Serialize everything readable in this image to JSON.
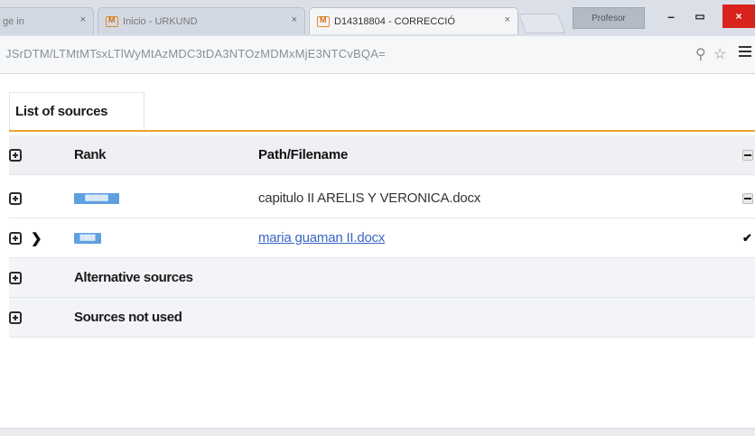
{
  "browser": {
    "tabs": [
      {
        "label": "ge in",
        "close": "×",
        "active": false
      },
      {
        "label": "Inicio - URKUND",
        "close": "×",
        "active": false
      },
      {
        "label": "D14318804 - CORRECCIÓ",
        "close": "×",
        "active": true
      }
    ],
    "profile_label": "Profesor",
    "window": {
      "minimize": "–",
      "restore": "▭",
      "close": "×"
    },
    "url": "JSrDTM/LTMtMTsxLTlWyMtAzMDC3tDA3NTOzMDMxMjE3NTCvBQA=",
    "icons": {
      "zoom": "zoom-icon",
      "star": "star-icon",
      "menu": "menu-icon"
    }
  },
  "page": {
    "section_tab": "List of sources",
    "accent_color": "#f0a030",
    "header": {
      "rank": "Rank",
      "path": "Path/Filename"
    },
    "rows": [
      {
        "badge": "██████",
        "path": "capitulo II ARELIS Y VERONICA.docx",
        "state": "minus"
      },
      {
        "badge": "████",
        "path": "maria guaman II.docx",
        "state": "check"
      }
    ],
    "groups": [
      {
        "label": "Alternative sources"
      },
      {
        "label": "Sources not used"
      }
    ]
  }
}
